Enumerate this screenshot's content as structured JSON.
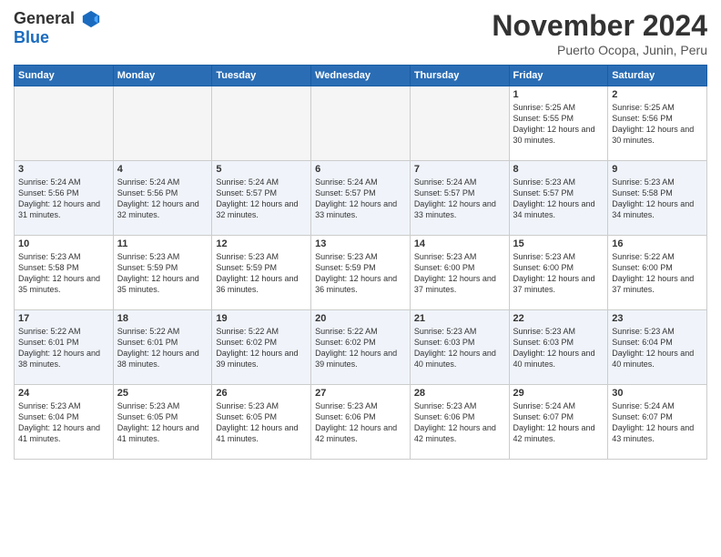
{
  "logo": {
    "general": "General",
    "blue": "Blue"
  },
  "title": "November 2024",
  "subtitle": "Puerto Ocopa, Junin, Peru",
  "days_of_week": [
    "Sunday",
    "Monday",
    "Tuesday",
    "Wednesday",
    "Thursday",
    "Friday",
    "Saturday"
  ],
  "weeks": [
    [
      {
        "day": "",
        "empty": true
      },
      {
        "day": "",
        "empty": true
      },
      {
        "day": "",
        "empty": true
      },
      {
        "day": "",
        "empty": true
      },
      {
        "day": "",
        "empty": true
      },
      {
        "day": "1",
        "sunrise": "5:25 AM",
        "sunset": "5:55 PM",
        "daylight": "12 hours and 30 minutes."
      },
      {
        "day": "2",
        "sunrise": "5:25 AM",
        "sunset": "5:56 PM",
        "daylight": "12 hours and 30 minutes."
      }
    ],
    [
      {
        "day": "3",
        "sunrise": "5:24 AM",
        "sunset": "5:56 PM",
        "daylight": "12 hours and 31 minutes."
      },
      {
        "day": "4",
        "sunrise": "5:24 AM",
        "sunset": "5:56 PM",
        "daylight": "12 hours and 32 minutes."
      },
      {
        "day": "5",
        "sunrise": "5:24 AM",
        "sunset": "5:57 PM",
        "daylight": "12 hours and 32 minutes."
      },
      {
        "day": "6",
        "sunrise": "5:24 AM",
        "sunset": "5:57 PM",
        "daylight": "12 hours and 33 minutes."
      },
      {
        "day": "7",
        "sunrise": "5:24 AM",
        "sunset": "5:57 PM",
        "daylight": "12 hours and 33 minutes."
      },
      {
        "day": "8",
        "sunrise": "5:23 AM",
        "sunset": "5:57 PM",
        "daylight": "12 hours and 34 minutes."
      },
      {
        "day": "9",
        "sunrise": "5:23 AM",
        "sunset": "5:58 PM",
        "daylight": "12 hours and 34 minutes."
      }
    ],
    [
      {
        "day": "10",
        "sunrise": "5:23 AM",
        "sunset": "5:58 PM",
        "daylight": "12 hours and 35 minutes."
      },
      {
        "day": "11",
        "sunrise": "5:23 AM",
        "sunset": "5:59 PM",
        "daylight": "12 hours and 35 minutes."
      },
      {
        "day": "12",
        "sunrise": "5:23 AM",
        "sunset": "5:59 PM",
        "daylight": "12 hours and 36 minutes."
      },
      {
        "day": "13",
        "sunrise": "5:23 AM",
        "sunset": "5:59 PM",
        "daylight": "12 hours and 36 minutes."
      },
      {
        "day": "14",
        "sunrise": "5:23 AM",
        "sunset": "6:00 PM",
        "daylight": "12 hours and 37 minutes."
      },
      {
        "day": "15",
        "sunrise": "5:23 AM",
        "sunset": "6:00 PM",
        "daylight": "12 hours and 37 minutes."
      },
      {
        "day": "16",
        "sunrise": "5:22 AM",
        "sunset": "6:00 PM",
        "daylight": "12 hours and 37 minutes."
      }
    ],
    [
      {
        "day": "17",
        "sunrise": "5:22 AM",
        "sunset": "6:01 PM",
        "daylight": "12 hours and 38 minutes."
      },
      {
        "day": "18",
        "sunrise": "5:22 AM",
        "sunset": "6:01 PM",
        "daylight": "12 hours and 38 minutes."
      },
      {
        "day": "19",
        "sunrise": "5:22 AM",
        "sunset": "6:02 PM",
        "daylight": "12 hours and 39 minutes."
      },
      {
        "day": "20",
        "sunrise": "5:22 AM",
        "sunset": "6:02 PM",
        "daylight": "12 hours and 39 minutes."
      },
      {
        "day": "21",
        "sunrise": "5:23 AM",
        "sunset": "6:03 PM",
        "daylight": "12 hours and 40 minutes."
      },
      {
        "day": "22",
        "sunrise": "5:23 AM",
        "sunset": "6:03 PM",
        "daylight": "12 hours and 40 minutes."
      },
      {
        "day": "23",
        "sunrise": "5:23 AM",
        "sunset": "6:04 PM",
        "daylight": "12 hours and 40 minutes."
      }
    ],
    [
      {
        "day": "24",
        "sunrise": "5:23 AM",
        "sunset": "6:04 PM",
        "daylight": "12 hours and 41 minutes."
      },
      {
        "day": "25",
        "sunrise": "5:23 AM",
        "sunset": "6:05 PM",
        "daylight": "12 hours and 41 minutes."
      },
      {
        "day": "26",
        "sunrise": "5:23 AM",
        "sunset": "6:05 PM",
        "daylight": "12 hours and 41 minutes."
      },
      {
        "day": "27",
        "sunrise": "5:23 AM",
        "sunset": "6:06 PM",
        "daylight": "12 hours and 42 minutes."
      },
      {
        "day": "28",
        "sunrise": "5:23 AM",
        "sunset": "6:06 PM",
        "daylight": "12 hours and 42 minutes."
      },
      {
        "day": "29",
        "sunrise": "5:24 AM",
        "sunset": "6:07 PM",
        "daylight": "12 hours and 42 minutes."
      },
      {
        "day": "30",
        "sunrise": "5:24 AM",
        "sunset": "6:07 PM",
        "daylight": "12 hours and 43 minutes."
      }
    ]
  ]
}
